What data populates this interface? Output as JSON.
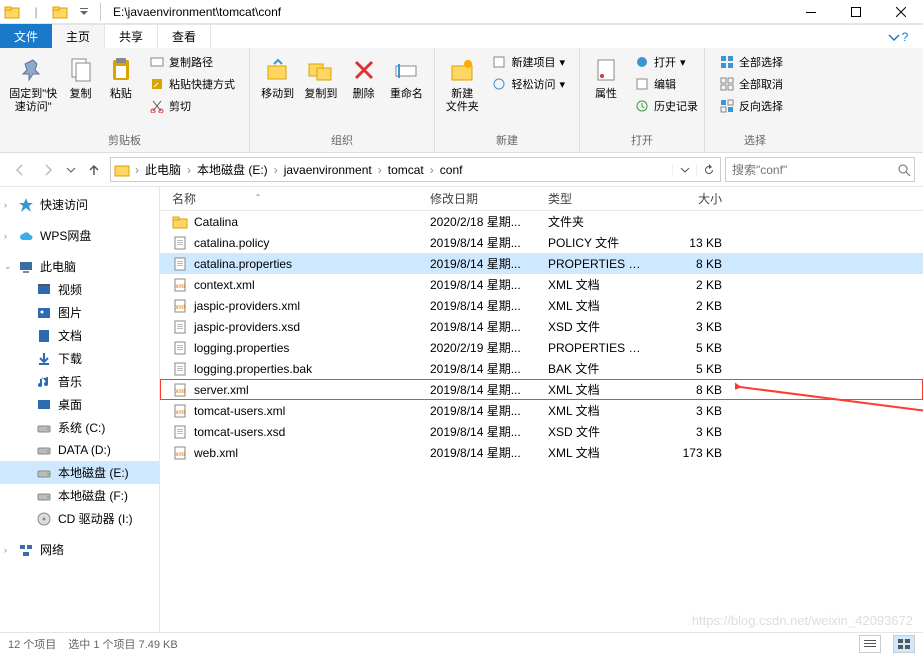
{
  "title_path": "E:\\javaenvironment\\tomcat\\conf",
  "tabs": {
    "file": "文件",
    "home": "主页",
    "share": "共享",
    "view": "查看"
  },
  "ribbon": {
    "pin": "固定到\"快\n速访问\"",
    "copy": "复制",
    "paste": "粘贴",
    "copy_path": "复制路径",
    "paste_shortcut": "粘贴快捷方式",
    "cut": "剪切",
    "clipboard": "剪贴板",
    "move_to": "移动到",
    "copy_to": "复制到",
    "delete": "删除",
    "rename": "重命名",
    "organize": "组织",
    "new_folder": "新建\n文件夹",
    "new_item": "新建项目",
    "easy_access": "轻松访问",
    "new": "新建",
    "properties": "属性",
    "open": "打开",
    "edit": "编辑",
    "history": "历史记录",
    "open_group": "打开",
    "select_all": "全部选择",
    "select_none": "全部取消",
    "invert": "反向选择",
    "select": "选择"
  },
  "breadcrumbs": [
    "此电脑",
    "本地磁盘 (E:)",
    "javaenvironment",
    "tomcat",
    "conf"
  ],
  "search_placeholder": "搜索\"conf\"",
  "columns": {
    "name": "名称",
    "date": "修改日期",
    "type": "类型",
    "size": "大小"
  },
  "nav": [
    {
      "icon": "star",
      "label": "快速访问",
      "color": "#3b97d3",
      "expandable": true
    },
    {
      "icon": "cloud",
      "label": "WPS网盘",
      "color": "#3aaee8",
      "expandable": true
    },
    {
      "icon": "pc",
      "label": "此电脑",
      "color": "#3b6ea5",
      "expandable": true,
      "expanded": true
    },
    {
      "icon": "video",
      "label": "视频",
      "sub": true,
      "color": "#2b6cb0"
    },
    {
      "icon": "image",
      "label": "图片",
      "sub": true,
      "color": "#2b6cb0"
    },
    {
      "icon": "doc",
      "label": "文档",
      "sub": true,
      "color": "#2b6cb0"
    },
    {
      "icon": "download",
      "label": "下载",
      "sub": true,
      "color": "#2b6cb0"
    },
    {
      "icon": "music",
      "label": "音乐",
      "sub": true,
      "color": "#2b6cb0"
    },
    {
      "icon": "desktop",
      "label": "桌面",
      "sub": true,
      "color": "#2b6cb0"
    },
    {
      "icon": "drive",
      "label": "系统 (C:)",
      "sub": true,
      "color": "#888"
    },
    {
      "icon": "drive",
      "label": "DATA (D:)",
      "sub": true,
      "color": "#888"
    },
    {
      "icon": "drive",
      "label": "本地磁盘 (E:)",
      "sub": true,
      "color": "#888",
      "selected": true
    },
    {
      "icon": "drive",
      "label": "本地磁盘 (F:)",
      "sub": true,
      "color": "#888"
    },
    {
      "icon": "cd",
      "label": "CD 驱动器 (I:)",
      "sub": true,
      "color": "#555"
    },
    {
      "icon": "network",
      "label": "网络",
      "color": "#3b6ea5",
      "expandable": true
    }
  ],
  "files": [
    {
      "icon": "folder",
      "name": "Catalina",
      "date": "2020/2/18 星期...",
      "type": "文件夹",
      "size": ""
    },
    {
      "icon": "file",
      "name": "catalina.policy",
      "date": "2019/8/14 星期...",
      "type": "POLICY 文件",
      "size": "13 KB"
    },
    {
      "icon": "file",
      "name": "catalina.properties",
      "date": "2019/8/14 星期...",
      "type": "PROPERTIES 文件",
      "size": "8 KB",
      "selected": true
    },
    {
      "icon": "xml",
      "name": "context.xml",
      "date": "2019/8/14 星期...",
      "type": "XML 文档",
      "size": "2 KB"
    },
    {
      "icon": "xml",
      "name": "jaspic-providers.xml",
      "date": "2019/8/14 星期...",
      "type": "XML 文档",
      "size": "2 KB"
    },
    {
      "icon": "file",
      "name": "jaspic-providers.xsd",
      "date": "2019/8/14 星期...",
      "type": "XSD 文件",
      "size": "3 KB"
    },
    {
      "icon": "file",
      "name": "logging.properties",
      "date": "2020/2/19 星期...",
      "type": "PROPERTIES 文件",
      "size": "5 KB"
    },
    {
      "icon": "file",
      "name": "logging.properties.bak",
      "date": "2019/8/14 星期...",
      "type": "BAK 文件",
      "size": "5 KB"
    },
    {
      "icon": "xml",
      "name": "server.xml",
      "date": "2019/8/14 星期...",
      "type": "XML 文档",
      "size": "8 KB",
      "highlighted": true
    },
    {
      "icon": "xml",
      "name": "tomcat-users.xml",
      "date": "2019/8/14 星期...",
      "type": "XML 文档",
      "size": "3 KB"
    },
    {
      "icon": "file",
      "name": "tomcat-users.xsd",
      "date": "2019/8/14 星期...",
      "type": "XSD 文件",
      "size": "3 KB"
    },
    {
      "icon": "xml",
      "name": "web.xml",
      "date": "2019/8/14 星期...",
      "type": "XML 文档",
      "size": "173 KB"
    }
  ],
  "status": {
    "count": "12 个项目",
    "selection": "选中 1 个项目 7.49 KB"
  },
  "watermark": "https://blog.csdn.net/weixin_42093672"
}
